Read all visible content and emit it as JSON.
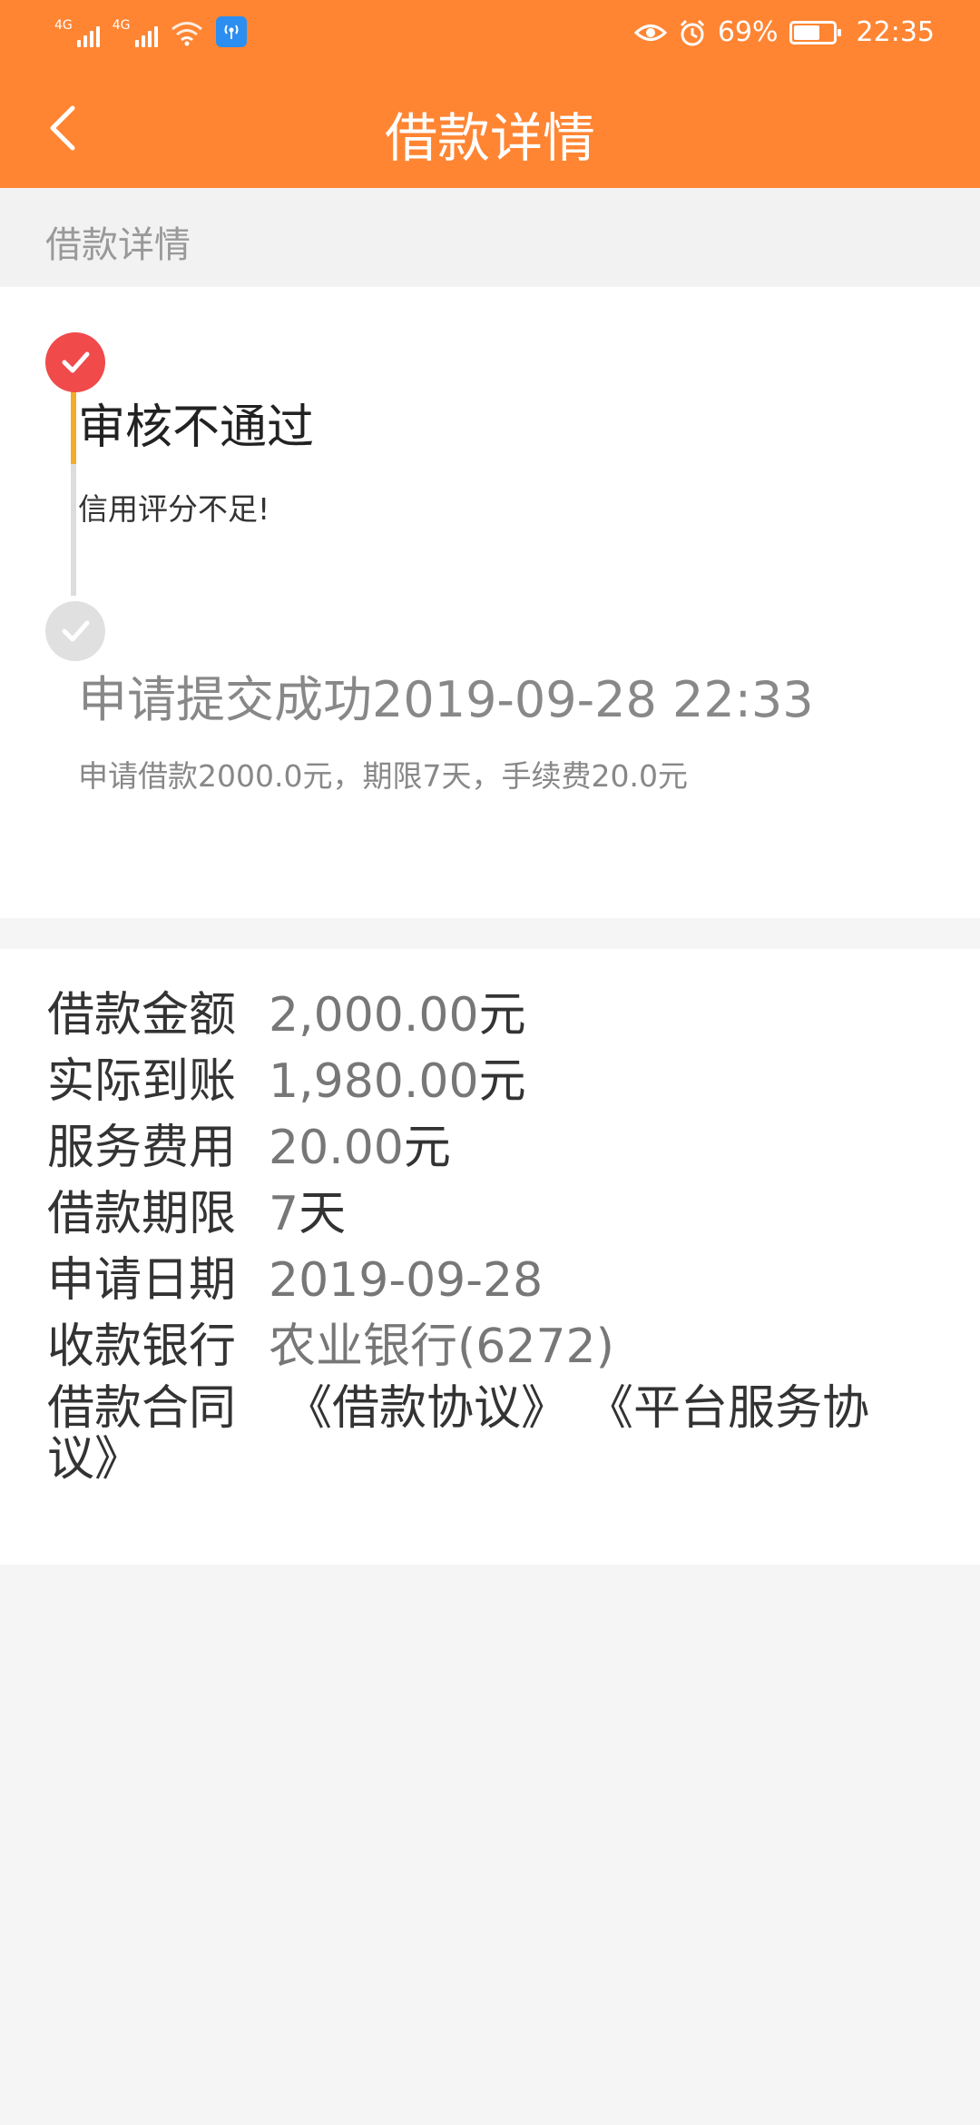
{
  "status_bar": {
    "network1": "4G",
    "network2": "4G",
    "battery_percent": "69%",
    "time": "22:35",
    "icons": [
      "signal-icon",
      "signal-icon",
      "wifi-icon",
      "hotspot-icon",
      "eye-icon",
      "alarm-icon",
      "battery-icon"
    ]
  },
  "nav": {
    "title": "借款详情"
  },
  "section_header": "借款详情",
  "timeline": [
    {
      "title": "审核不通过",
      "description": "信用评分不足!",
      "status": "rejected",
      "color": "#f04a4a"
    },
    {
      "title": "申请提交成功2019-09-28 22:33",
      "description": "申请借款2000.0元，期限7天，手续费20.0元",
      "status": "submitted",
      "color": "#e0e0e0"
    }
  ],
  "details": {
    "amount": {
      "label": "借款金额",
      "value": "2,000.00",
      "unit": "元"
    },
    "received": {
      "label": "实际到账",
      "value": "1,980.00",
      "unit": "元"
    },
    "fee": {
      "label": "服务费用",
      "value": "20.00",
      "unit": "元"
    },
    "term": {
      "label": "借款期限",
      "value": "7",
      "unit": "天"
    },
    "date": {
      "label": "申请日期",
      "value": "2019-09-28"
    },
    "bank": {
      "label": "收款银行",
      "value": "农业银行(6272)"
    },
    "contract": {
      "label": "借款合同",
      "link1": "《借款协议》",
      "link2": "《平台服务协议》"
    }
  },
  "colors": {
    "brand": "#ff8533",
    "rejected": "#f04a4a",
    "timeline_active": "#f0ad2a"
  }
}
